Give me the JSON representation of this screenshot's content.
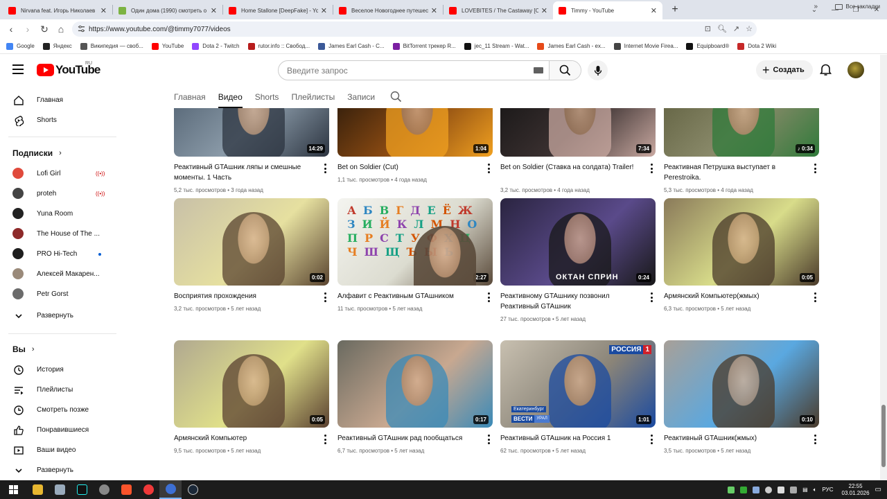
{
  "browser": {
    "tabs": [
      {
        "title": "Nirvana feat. Игорь Николаев",
        "favicon_color": "#ff0000",
        "active": false
      },
      {
        "title": "Один дома (1990) смотреть о",
        "favicon_color": "#7cb342",
        "active": false
      },
      {
        "title": "Home Stallone [DeepFake] - Yo",
        "favicon_color": "#ff0000",
        "active": false
      },
      {
        "title": "Веселое Новогоднее путешес",
        "favicon_color": "#ff0000",
        "active": false
      },
      {
        "title": "LOVEBITES / The Castaway [Off",
        "favicon_color": "#ff0000",
        "active": false
      },
      {
        "title": "Timmy - YouTube",
        "favicon_color": "#ff0000",
        "active": true
      }
    ],
    "new_tab": "+",
    "url": "https://www.youtube.com/@timmy7077/videos",
    "bookmarks": [
      {
        "label": "Google",
        "color": "#4285f4"
      },
      {
        "label": "Яндекс",
        "color": "#222222"
      },
      {
        "label": "Википедия — своб...",
        "color": "#555555"
      },
      {
        "label": "YouTube",
        "color": "#ff0000"
      },
      {
        "label": "Dota 2 - Twitch",
        "color": "#9146ff"
      },
      {
        "label": "rutor.info :: Свобод...",
        "color": "#b71c1c"
      },
      {
        "label": "James Earl Cash - C...",
        "color": "#3b5998"
      },
      {
        "label": "BitTorrent трекер R...",
        "color": "#7b1fa2"
      },
      {
        "label": "jec_11 Stream - Wat...",
        "color": "#111111"
      },
      {
        "label": "James Earl Cash - ex...",
        "color": "#e64a19"
      },
      {
        "label": "Internet Movie Firea...",
        "color": "#444444"
      },
      {
        "label": "Equipboard®",
        "color": "#111111"
      },
      {
        "label": "Dota 2 Wiki",
        "color": "#c62828"
      }
    ],
    "bookmarks_more": "»",
    "all_bookmarks": "Все закладки"
  },
  "header": {
    "logo_text": "YouTube",
    "logo_region": "RU",
    "search_placeholder": "Введите запрос",
    "create_label": "Создать",
    "create_plus": "+"
  },
  "sidebar": {
    "main": [
      {
        "label": "Главная",
        "icon": "home-icon"
      },
      {
        "label": "Shorts",
        "icon": "shorts-icon"
      }
    ],
    "subscriptions_title": "Подписки",
    "subscriptions": [
      {
        "label": "Lofi Girl",
        "color": "#e04a3c",
        "status": "live"
      },
      {
        "label": "proteh",
        "color": "#444444",
        "status": "live"
      },
      {
        "label": "Yuna Room",
        "color": "#222222",
        "status": ""
      },
      {
        "label": "The House of The ...",
        "color": "#8d2a2a",
        "status": ""
      },
      {
        "label": "PRO Hi-Tech",
        "color": "#1e1e1e",
        "status": "new"
      },
      {
        "label": "Алексей Макарен...",
        "color": "#9a8a7a",
        "status": ""
      },
      {
        "label": "Petr Gorst",
        "color": "#6b6b6b",
        "status": ""
      }
    ],
    "expand_label": "Развернуть",
    "you_title": "Вы",
    "you_items": [
      {
        "label": "История",
        "icon": "history-icon"
      },
      {
        "label": "Плейлисты",
        "icon": "playlists-icon"
      },
      {
        "label": "Смотреть позже",
        "icon": "watch-later-icon"
      },
      {
        "label": "Понравившиеся",
        "icon": "liked-icon"
      },
      {
        "label": "Ваши видео",
        "icon": "your-videos-icon"
      },
      {
        "label": "Развернуть",
        "icon": "chevron-down-icon"
      }
    ]
  },
  "channel_tabs": [
    {
      "label": "Главная",
      "active": false
    },
    {
      "label": "Видео",
      "active": true
    },
    {
      "label": "Shorts",
      "active": false
    },
    {
      "label": "Плейлисты",
      "active": false
    },
    {
      "label": "Записи",
      "active": false
    }
  ],
  "videos": [
    {
      "title": "Реактивный GTAшник ляпы и смешные моменты. 1 Часть",
      "views": "5,2 тыс. просмотров",
      "age": "3 года назад",
      "duration": "14:29",
      "colors": [
        "#4a5a6a",
        "#8a9aa8",
        "#2c3440"
      ]
    },
    {
      "title": "Bet on Soldier (Cut)",
      "views": "1,1 тыс. просмотров",
      "age": "4 года назад",
      "duration": "1:04",
      "colors": [
        "#1b120a",
        "#8a4a12",
        "#f0a020"
      ]
    },
    {
      "title": "Bet on Soldier (Ставка на солдата) Trailer!",
      "views": "3,2 тыс. просмотров",
      "age": "4 года назад",
      "duration": "7:34",
      "colors": [
        "#111111",
        "#3a3030",
        "#c8a8a0"
      ]
    },
    {
      "title": "Реактивная Петрушка выступает в Perestroika.",
      "views": "5,3 тыс. просмотров",
      "age": "4 года назад",
      "duration": "0:34",
      "colors": [
        "#5a5a3a",
        "#8a8a6a",
        "#2f7a3a"
      ],
      "shorts": true
    },
    {
      "title": "Восприятия прохождения",
      "views": "3,2 тыс. просмотров",
      "age": "5 лет назад",
      "duration": "0:02",
      "colors": [
        "#c8c0a8",
        "#e6e0a0",
        "#5a4430"
      ]
    },
    {
      "title": "Алфавит с Реактивным GTAшником",
      "views": "11 тыс. просмотров",
      "age": "5 лет назад",
      "duration": "2:27",
      "colors": [
        "#f4f4f0",
        "#dcdcd0",
        "#5a4a3a"
      ]
    },
    {
      "title": "Реактивному GTAшнику позвонил Реактивный GTAшник",
      "views": "27 тыс. просмотров",
      "age": "5 лет назад",
      "duration": "0:24",
      "colors": [
        "#2a2440",
        "#5a4a8a",
        "#181818"
      ]
    },
    {
      "title": "Армянский Компьютер(жмых)",
      "views": "6,3 тыс. просмотров",
      "age": "5 лет назад",
      "duration": "0:05",
      "colors": [
        "#8a7a5a",
        "#d8dc8a",
        "#4a3a2a"
      ]
    },
    {
      "title": "Армянский Компьютер",
      "views": "9,5 тыс. просмотров",
      "age": "5 лет назад",
      "duration": "0:05",
      "colors": [
        "#b0a890",
        "#e0e08a",
        "#5a4030"
      ]
    },
    {
      "title": "Реактивный GTAшник рад пообщаться",
      "views": "6,7 тыс. просмотров",
      "age": "5 лет назад",
      "duration": "0:17",
      "colors": [
        "#6a6a60",
        "#c8a890",
        "#3a8ab8"
      ]
    },
    {
      "title": "Реактивный GTAшник на Россия 1",
      "views": "62 тыс. просмотров",
      "age": "5 лет назад",
      "duration": "1:01",
      "colors": [
        "#c8c0b0",
        "#8a8478",
        "#1a4aa0"
      ],
      "overlay": {
        "top": "РОССИЯ",
        "num": "1",
        "city": "Екатеринбург",
        "news": "ВЕСТИ",
        "region": "УРАЛ"
      }
    },
    {
      "title": "Реактивный GTAшник(жмых)",
      "views": "3,5 тыс. просмотров",
      "age": "5 лет назад",
      "duration": "0:10",
      "colors": [
        "#a8a098",
        "#5aa8e0",
        "#4a3a2a"
      ]
    }
  ],
  "alphabet_letters": [
    "А",
    "Б",
    "В",
    "Г",
    "Д",
    "Е",
    "Ё",
    "Ж",
    "З",
    "И",
    "Й",
    "К",
    "Л",
    "М",
    "Н",
    "О",
    "П",
    "Р",
    "С",
    "Т",
    "У",
    "Ф",
    "Х",
    "Ц",
    "Ч",
    "Ш",
    "Щ",
    "Ъ",
    "Ы",
    "Ь"
  ],
  "game_overlay": "ОКТАН СПРИН",
  "taskbar": {
    "lang": "РУС",
    "time": "22:55",
    "date": "03.01.2026"
  }
}
